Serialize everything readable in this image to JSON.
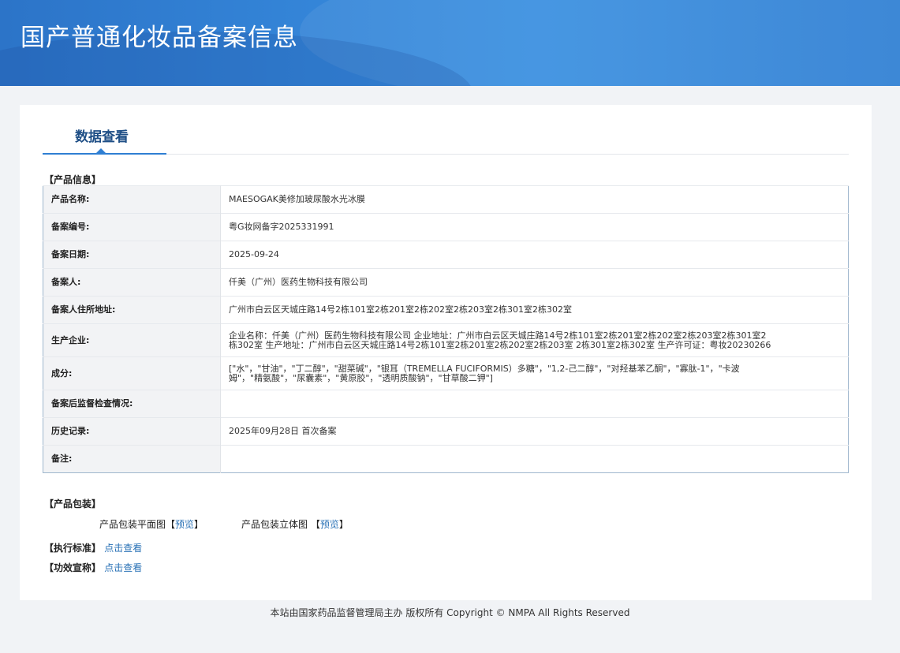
{
  "header": {
    "title": "国产普通化妆品备案信息"
  },
  "tabs": [
    {
      "label": "数据查看"
    }
  ],
  "product_section": {
    "title": "【产品信息】",
    "rows": [
      {
        "label": "产品名称:",
        "value": "MAESOGAK美修加玻尿酸水光冰膜"
      },
      {
        "label": "备案编号:",
        "value": "粤G妆网备字2025331991"
      },
      {
        "label": "备案日期:",
        "value": "2025-09-24"
      },
      {
        "label": "备案人:",
        "value": "仟美（广州）医药生物科技有限公司"
      },
      {
        "label": "备案人住所地址:",
        "value": "广州市白云区天城庄路14号2栋101室2栋201室2栋202室2栋203室2栋301室2栋302室"
      },
      {
        "label": "生产企业:",
        "value_lines": [
          "企业名称：仟美（广州）医药生物科技有限公司 企业地址：广州市白云区天城庄路14号2栋101室2栋201室2栋202室2栋203室2栋301室2",
          "栋302室 生产地址：广州市白云区天城庄路14号2栋101室2栋201室2栋202室2栋203室 2栋301室2栋302室 生产许可证：粤妆20230266"
        ]
      },
      {
        "label": "成分:",
        "value_lines": [
          "[\"水\"，\"甘油\"，\"丁二醇\"，\"甜菜碱\"，\"银耳（TREMELLA FUCIFORMIS）多糖\"，\"1,2-己二醇\"，\"对羟基苯乙酮\"，\"寡肽-1\"，\"卡波",
          "姆\"，\"精氨酸\"，\"尿囊素\"，\"黄原胶\"，\"透明质酸钠\"，\"甘草酸二钾\"]"
        ]
      },
      {
        "label": "备案后监督检查情况:",
        "value": ""
      },
      {
        "label": "历史记录:",
        "value": "2025年09月28日 首次备案"
      },
      {
        "label": "备注:",
        "value": ""
      }
    ]
  },
  "packaging_section": {
    "title": "【产品包装】",
    "items": [
      {
        "label": "产品包装平面图",
        "link": "预览",
        "bracket_open": "【",
        "bracket_close": "】"
      },
      {
        "label": "产品包装立体图",
        "link": "预览",
        "bracket_open": " 【",
        "bracket_close": "】"
      }
    ]
  },
  "standard_section": {
    "title": "【执行标准】",
    "link": "点击查看"
  },
  "efficacy_section": {
    "title": "【功效宣称】",
    "link": "点击查看"
  },
  "footer": {
    "text": "本站由国家药品监督管理局主办 版权所有 Copyright © NMPA All Rights Reserved"
  },
  "colors": {
    "banner": "#3485d8",
    "tab_text": "#1f4f86",
    "link": "#2a72b6",
    "table_border": "#9fb6cd"
  }
}
